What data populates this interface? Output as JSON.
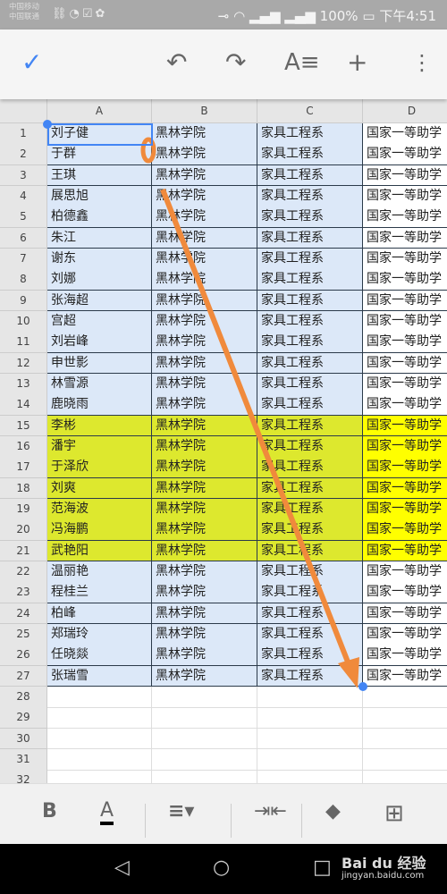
{
  "status_bar": {
    "carrier1": "中国移动",
    "carrier2": "中国联通",
    "battery": "100%",
    "time": "下午4:51",
    "network1": "2G",
    "network2": "4G"
  },
  "toolbar": {
    "icons": [
      "check-icon",
      "undo-icon",
      "redo-icon",
      "text-format-icon",
      "add-icon",
      "more-vert-icon"
    ]
  },
  "columns": [
    "A",
    "B",
    "C",
    "D"
  ],
  "rows": [
    [
      "刘子健",
      "黑林学院",
      "家具工程系",
      "国家一等助学"
    ],
    [
      "于群",
      "黑林学院",
      "家具工程系",
      "国家一等助学"
    ],
    [
      "王琪",
      "黑林学院",
      "家具工程系",
      "国家一等助学"
    ],
    [
      "展思旭",
      "黑林学院",
      "家具工程系",
      "国家一等助学"
    ],
    [
      "柏德鑫",
      "黑林学院",
      "家具工程系",
      "国家一等助学"
    ],
    [
      "朱江",
      "黑林学院",
      "家具工程系",
      "国家一等助学"
    ],
    [
      "谢东",
      "黑林学院",
      "家具工程系",
      "国家一等助学"
    ],
    [
      "刘娜",
      "黑林学院",
      "家具工程系",
      "国家一等助学"
    ],
    [
      "张海超",
      "黑林学院",
      "家具工程系",
      "国家一等助学"
    ],
    [
      "宫超",
      "黑林学院",
      "家具工程系",
      "国家一等助学"
    ],
    [
      "刘岩峰",
      "黑林学院",
      "家具工程系",
      "国家一等助学"
    ],
    [
      "申世影",
      "黑林学院",
      "家具工程系",
      "国家一等助学"
    ],
    [
      "林雪源",
      "黑林学院",
      "家具工程系",
      "国家一等助学"
    ],
    [
      "鹿晓雨",
      "黑林学院",
      "家具工程系",
      "国家一等助学"
    ],
    [
      "李彬",
      "黑林学院",
      "家具工程系",
      "国家一等助学"
    ],
    [
      "潘宇",
      "黑林学院",
      "家具工程系",
      "国家一等助学"
    ],
    [
      "于泽欣",
      "黑林学院",
      "家具工程系",
      "国家一等助学"
    ],
    [
      "刘爽",
      "黑林学院",
      "家具工程系",
      "国家一等助学"
    ],
    [
      "范海波",
      "黑林学院",
      "家具工程系",
      "国家一等助学"
    ],
    [
      "冯海鹏",
      "黑林学院",
      "家具工程系",
      "国家一等助学"
    ],
    [
      "武艳阳",
      "黑林学院",
      "家具工程系",
      "国家一等助学"
    ],
    [
      "温丽艳",
      "黑林学院",
      "家具工程系",
      "国家一等助学"
    ],
    [
      "程桂兰",
      "黑林学院",
      "家具工程系",
      "国家一等助学"
    ],
    [
      "柏峰",
      "黑林学院",
      "家具工程系",
      "国家一等助学"
    ],
    [
      "郑瑞玲",
      "黑林学院",
      "家具工程系",
      "国家一等助学"
    ],
    [
      "任晓燚",
      "黑林学院",
      "家具工程系",
      "国家一等助学"
    ],
    [
      "张瑞雪",
      "黑林学院",
      "家具工程系",
      "国家一等助学"
    ]
  ],
  "empty_row_numbers": [
    28,
    29,
    30,
    31,
    32
  ],
  "highlighted_rows": [
    15,
    16,
    17,
    18,
    19,
    20,
    21
  ],
  "selection": "A1:C27",
  "colors": {
    "selection": "#dce8f8",
    "highlight": "#ffff00",
    "highlight_selected": "#dde82e",
    "accent": "#4285f4",
    "annotation": "#f08a3c"
  },
  "bottom_toolbar": {
    "bold": "B",
    "text_color": "A",
    "icons": [
      "bold-icon",
      "text-color-icon",
      "align-icon",
      "merge-cells-icon",
      "fill-color-icon",
      "borders-icon"
    ]
  },
  "watermark": {
    "brand": "Bai du 经验",
    "url": "jingyan.baidu.com"
  }
}
